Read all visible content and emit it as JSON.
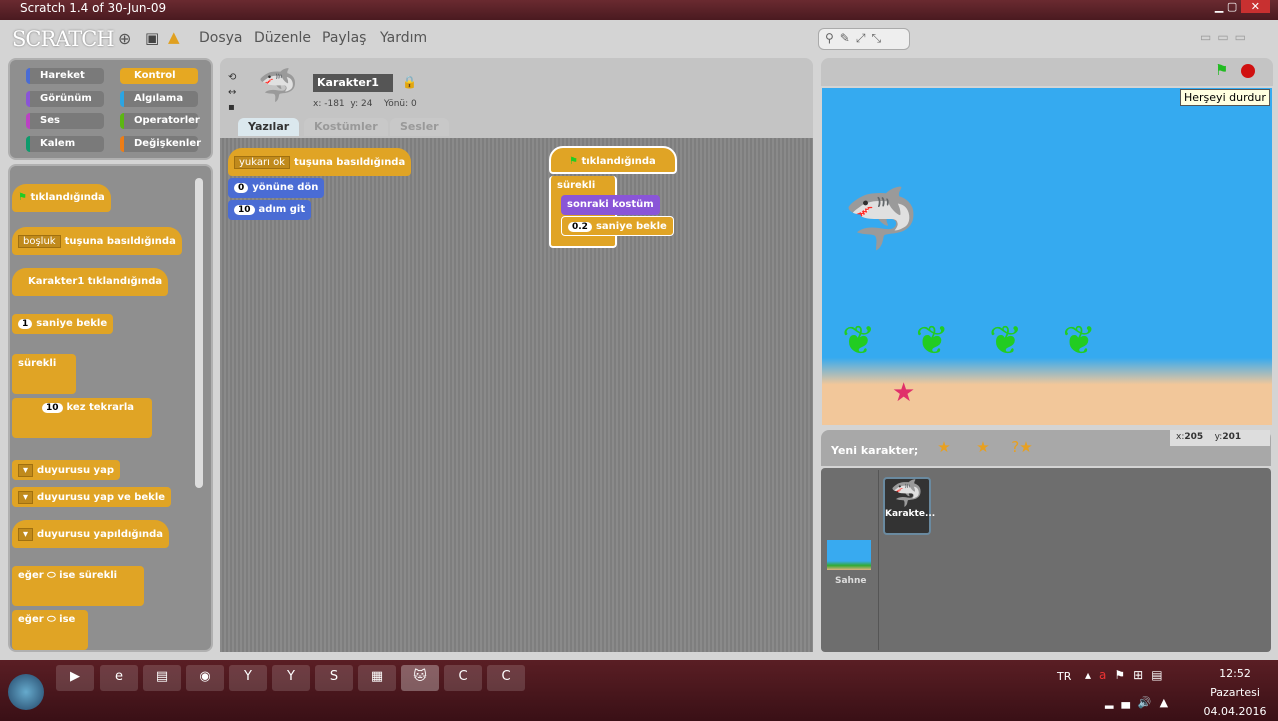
{
  "window": {
    "title": "Scratch 1.4 of 30-Jun-09"
  },
  "menu": {
    "logo": "SCRATCH",
    "items": [
      "Dosya",
      "Düzenle",
      "Paylaş",
      "Yardım"
    ]
  },
  "categories": [
    {
      "label": "Hareket",
      "color": "#4a6cd4"
    },
    {
      "label": "Kontrol",
      "color": "#e6a822"
    },
    {
      "label": "Görünüm",
      "color": "#8a55d7"
    },
    {
      "label": "Algılama",
      "color": "#2ca5e2"
    },
    {
      "label": "Ses",
      "color": "#bb42c3"
    },
    {
      "label": "Operatorler",
      "color": "#5cb712"
    },
    {
      "label": "Kalem",
      "color": "#0e9a6c"
    },
    {
      "label": "Değişkenler",
      "color": "#ee7d16"
    }
  ],
  "palette": {
    "green_flag": "tıklandığında",
    "key_dropdown": "boşluk",
    "key_text": "tuşuna basıldığında",
    "sprite_clicked": "Karakter1  tıklandığında",
    "wait_num": "1",
    "wait_text": "saniye bekle",
    "forever": "sürekli",
    "repeat_num": "10",
    "repeat_text": "kez tekrarla",
    "broadcast": "duyurusu yap",
    "broadcast_wait": "duyurusu yap ve bekle",
    "when_receive": "duyurusu yapıldığında",
    "forever_if_a": "eğer",
    "forever_if_b": "ise sürekli",
    "if_a": "eğer",
    "if_b": "ise"
  },
  "sprite": {
    "name": "Karakter1",
    "x_label": "x:",
    "x": "-181",
    "y_label": "y:",
    "y": "24",
    "dir_label": "Yönü:",
    "dir": "0"
  },
  "tabs": [
    {
      "label": "Yazılar",
      "active": true
    },
    {
      "label": "Kostümler"
    },
    {
      "label": "Sesler"
    }
  ],
  "scripts": {
    "s1_key": "yukarı ok",
    "s1_text": "tuşuna basıldığında",
    "s1_dir_num": "0",
    "s1_dir_text": "yönüne dön",
    "s1_move_num": "10",
    "s1_move_text": "adım git",
    "s2_flag": "tıklandığında",
    "s2_forever": "sürekli",
    "s2_costume": "sonraki kostüm",
    "s2_wait_num": "0.2",
    "s2_wait_text": "saniye bekle"
  },
  "stage": {
    "tooltip": "Herşeyi durdur",
    "mouse_x_label": "x:",
    "mouse_x": "205",
    "mouse_y_label": "y:",
    "mouse_y": "201"
  },
  "sprite_panel": {
    "new_sprite": "Yeni karakter;",
    "sprite_label": "Karakte...",
    "stage_label": "Sahne"
  },
  "taskbar": {
    "lang": "TR",
    "time": "12:52",
    "day": "Pazartesi",
    "date": "04.04.2016"
  }
}
